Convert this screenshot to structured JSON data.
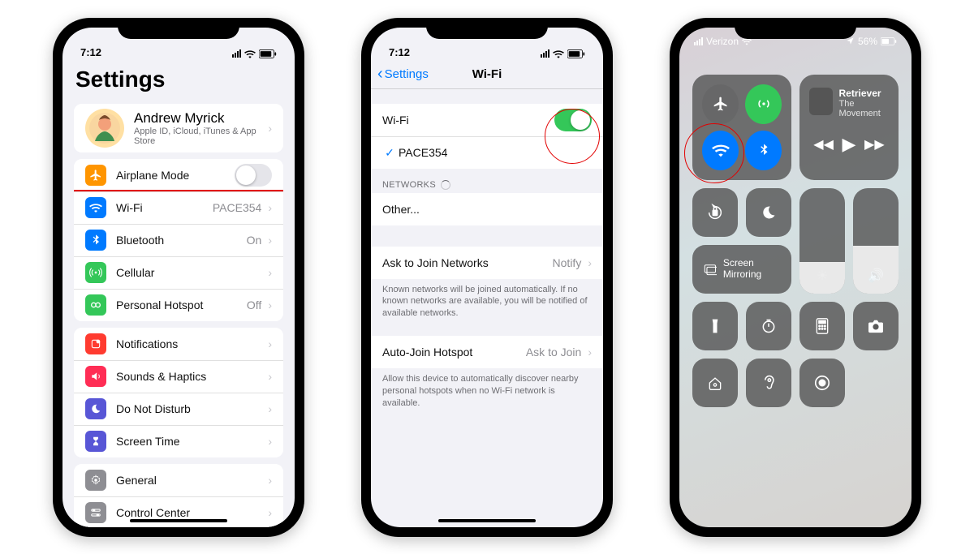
{
  "phone1": {
    "time": "7:12",
    "title": "Settings",
    "profile_name": "Andrew Myrick",
    "profile_sub": "Apple ID, iCloud, iTunes & App Store",
    "rows": {
      "airplane": "Airplane Mode",
      "wifi": "Wi-Fi",
      "wifi_value": "PACE354",
      "bluetooth": "Bluetooth",
      "bluetooth_value": "On",
      "cellular": "Cellular",
      "hotspot": "Personal Hotspot",
      "hotspot_value": "Off",
      "notifications": "Notifications",
      "sounds": "Sounds & Haptics",
      "dnd": "Do Not Disturb",
      "screentime": "Screen Time",
      "general": "General",
      "controlcenter": "Control Center"
    }
  },
  "phone2": {
    "time": "7:12",
    "back": "Settings",
    "title": "Wi-Fi",
    "wifi_label": "Wi-Fi",
    "connected": "PACE354",
    "networks_header": "NETWORKS",
    "other": "Other...",
    "ask_label": "Ask to Join Networks",
    "ask_value": "Notify",
    "ask_footer": "Known networks will be joined automatically. If no known networks are available, you will be notified of available networks.",
    "auto_label": "Auto-Join Hotspot",
    "auto_value": "Ask to Join",
    "auto_footer": "Allow this device to automatically discover nearby personal hotspots when no Wi-Fi network is available."
  },
  "phone3": {
    "carrier": "Verizon",
    "battery": "56%",
    "music_title": "Retriever",
    "music_artist": "The Movement",
    "screen_mirroring": "Screen Mirroring"
  }
}
